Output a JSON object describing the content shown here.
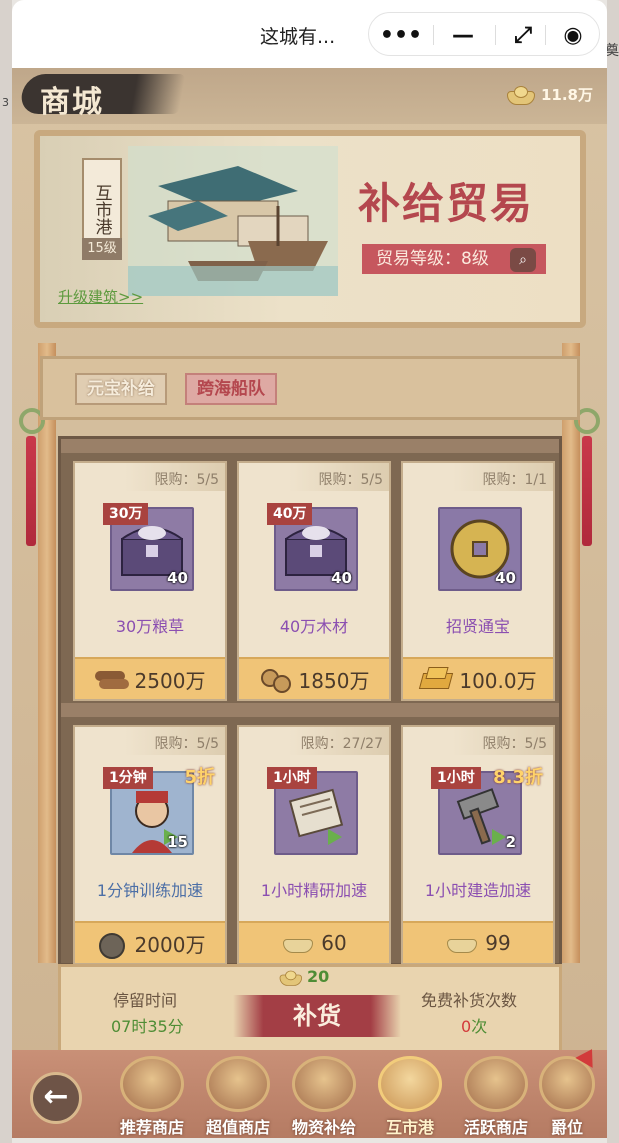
{
  "window": {
    "title": "这城有...",
    "capsule": {
      "more_icon": "•••",
      "minimize_icon": "—",
      "restore_icon": "⤢",
      "close_icon": "◉"
    },
    "side_left_text": "3",
    "side_right_text": "奠"
  },
  "header": {
    "title": "商城",
    "currency_value": "11.8万",
    "currency_icon": "ingot-icon"
  },
  "banner": {
    "port_name": "互市港",
    "port_level": "15级",
    "title": "补给贸易",
    "trade_level": "贸易等级：8级",
    "upgrade_link": "升级建筑>>"
  },
  "tabs": [
    {
      "label": "元宝补给",
      "active": false
    },
    {
      "label": "跨海船队",
      "active": true
    }
  ],
  "goods": [
    {
      "limit": "限购：5/5",
      "tag": "30万",
      "discount": "",
      "qty": "40",
      "name": "30万粮草",
      "name_color": "purple",
      "price": "2500万",
      "price_icon": "wood-icon",
      "item_icon": "treasure-chest-icon"
    },
    {
      "limit": "限购：5/5",
      "tag": "40万",
      "discount": "",
      "qty": "40",
      "name": "40万木材",
      "name_color": "purple",
      "price": "1850万",
      "price_icon": "logs-icon",
      "item_icon": "treasure-chest-icon"
    },
    {
      "limit": "限购：1/1",
      "tag": "",
      "discount": "",
      "qty": "40",
      "name": "招贤通宝",
      "name_color": "purple",
      "price": "100.0万",
      "price_icon": "gold-bar-icon",
      "item_icon": "coin-icon"
    },
    {
      "limit": "限购：5/5",
      "tag": "1分钟",
      "discount": "5折",
      "qty": "15",
      "name": "1分钟训练加速",
      "name_color": "blue",
      "price": "2000万",
      "price_icon": "coin-icon",
      "item_icon": "soldier-icon"
    },
    {
      "limit": "限购：27/27",
      "tag": "1小时",
      "discount": "",
      "qty": "",
      "name": "1小时精研加速",
      "name_color": "purple",
      "price": "60",
      "price_icon": "ingot-icon",
      "item_icon": "scroll-icon"
    },
    {
      "limit": "限购：5/5",
      "tag": "1小时",
      "discount": "8.3折",
      "qty": "2",
      "name": "1小时建造加速",
      "name_color": "purple",
      "price": "99",
      "price_icon": "ingot-icon",
      "item_icon": "hammer-icon"
    }
  ],
  "restock": {
    "stay_label": "停留时间",
    "stay_value": "07时35分",
    "button_label": "补货",
    "cost": "20",
    "free_label": "免费补货次数",
    "free_count": "0",
    "free_unit": "次"
  },
  "nav": {
    "back_icon": "←",
    "items": [
      {
        "label": "推荐商店",
        "current": false
      },
      {
        "label": "超值商店",
        "current": false
      },
      {
        "label": "物资补给",
        "current": false
      },
      {
        "label": "互市港",
        "current": true
      },
      {
        "label": "活跃商店",
        "current": false
      },
      {
        "label": "爵位",
        "current": false
      }
    ]
  }
}
